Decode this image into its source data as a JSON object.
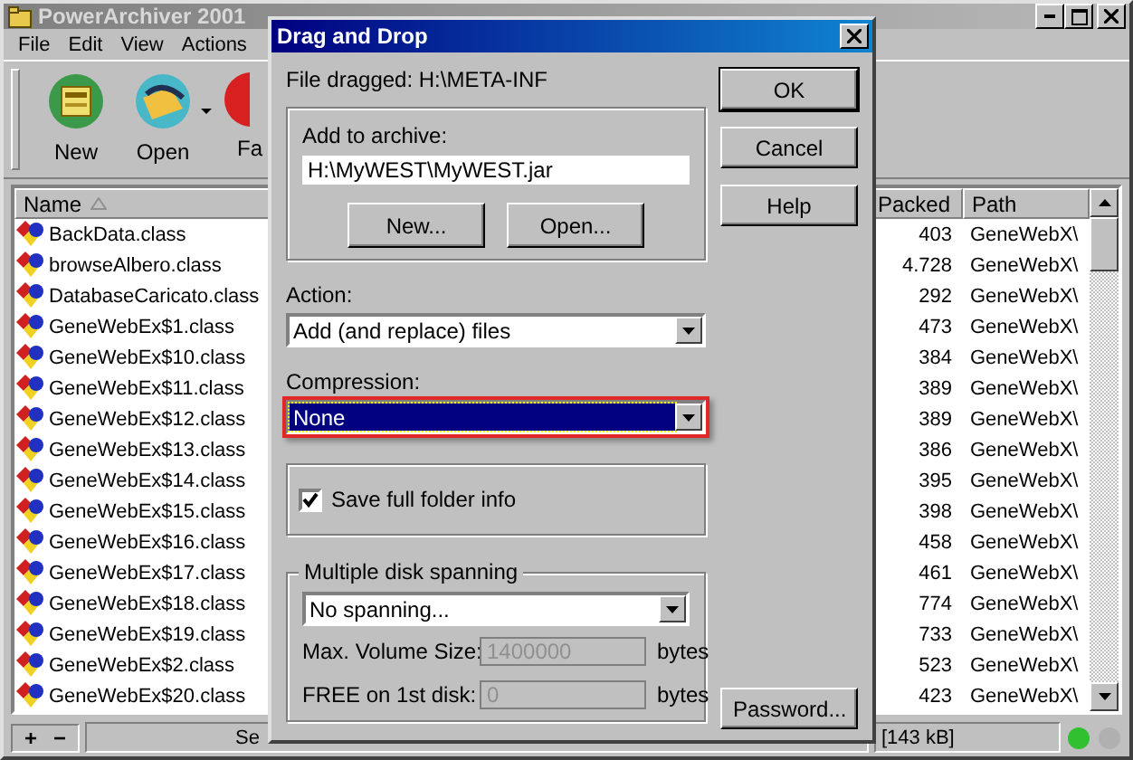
{
  "window": {
    "title": "PowerArchiver 2001"
  },
  "menu": [
    {
      "label": "File"
    },
    {
      "label": "Edit"
    },
    {
      "label": "View"
    },
    {
      "label": "Actions"
    }
  ],
  "toolbar": [
    {
      "label": "New",
      "kind": "new",
      "has_dropdown": false
    },
    {
      "label": "Open",
      "kind": "open",
      "has_dropdown": true
    },
    {
      "label": "Fa",
      "kind": "favorite",
      "has_dropdown": false
    }
  ],
  "table": {
    "columns": [
      {
        "label": "Name",
        "sorted": true
      },
      {
        "label": "Packed",
        "sorted": false
      },
      {
        "label": "Path",
        "sorted": false
      }
    ],
    "rows": [
      {
        "name": "BackData.class",
        "packed": "403",
        "path": "GeneWebX\\"
      },
      {
        "name": "browseAlbero.class",
        "packed": "4.728",
        "path": "GeneWebX\\"
      },
      {
        "name": "DatabaseCaricato.class",
        "packed": "292",
        "path": "GeneWebX\\"
      },
      {
        "name": "GeneWebEx$1.class",
        "packed": "473",
        "path": "GeneWebX\\"
      },
      {
        "name": "GeneWebEx$10.class",
        "packed": "384",
        "path": "GeneWebX\\"
      },
      {
        "name": "GeneWebEx$11.class",
        "packed": "389",
        "path": "GeneWebX\\"
      },
      {
        "name": "GeneWebEx$12.class",
        "packed": "389",
        "path": "GeneWebX\\"
      },
      {
        "name": "GeneWebEx$13.class",
        "packed": "386",
        "path": "GeneWebX\\"
      },
      {
        "name": "GeneWebEx$14.class",
        "packed": "395",
        "path": "GeneWebX\\"
      },
      {
        "name": "GeneWebEx$15.class",
        "packed": "398",
        "path": "GeneWebX\\"
      },
      {
        "name": "GeneWebEx$16.class",
        "packed": "458",
        "path": "GeneWebX\\"
      },
      {
        "name": "GeneWebEx$17.class",
        "packed": "461",
        "path": "GeneWebX\\"
      },
      {
        "name": "GeneWebEx$18.class",
        "packed": "774",
        "path": "GeneWebX\\"
      },
      {
        "name": "GeneWebEx$19.class",
        "packed": "733",
        "path": "GeneWebX\\"
      },
      {
        "name": "GeneWebEx$2.class",
        "packed": "523",
        "path": "GeneWebX\\"
      },
      {
        "name": "GeneWebEx$20.class",
        "packed": "423",
        "path": "GeneWebX\\"
      }
    ]
  },
  "status_bar": {
    "buttons": [
      "+",
      "−"
    ],
    "text": "Se",
    "size": "[143 kB]"
  },
  "dialog": {
    "title": "Drag and Drop",
    "file_dragged": "File dragged: H:\\META-INF",
    "archive": {
      "label": "Add to archive:",
      "value": "H:\\MyWEST\\MyWEST.jar",
      "buttons": [
        "New...",
        "Open..."
      ]
    },
    "action": {
      "label": "Action:",
      "value": "Add (and replace) files"
    },
    "compression": {
      "label": "Compression:",
      "value": "None",
      "highlighted": true
    },
    "save_folder_info": {
      "label": "Save full folder info",
      "checked": true
    },
    "spanning": {
      "title": "Multiple disk spanning",
      "value": "No spanning...",
      "fields": [
        {
          "label": "Max. Volume Size:",
          "value": "1400000",
          "unit": "bytes",
          "disabled": true
        },
        {
          "label": "FREE on 1st disk:",
          "value": "0",
          "unit": "bytes",
          "disabled": true
        }
      ]
    },
    "buttons": [
      {
        "label": "OK",
        "default": true
      },
      {
        "label": "Cancel",
        "default": false
      },
      {
        "label": "Help",
        "default": false
      }
    ],
    "password_button": "Password..."
  }
}
